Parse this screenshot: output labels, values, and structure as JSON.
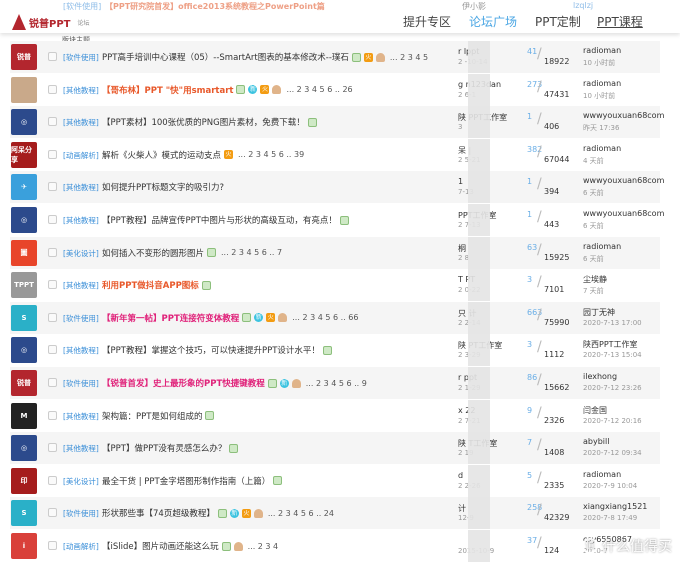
{
  "header": {
    "logo": "锐普PPT",
    "logo_sub": "论坛",
    "nav": [
      "提升专区",
      "论坛广场",
      "PPT定制",
      "PPT课程"
    ],
    "active": 1
  },
  "ghost_row": {
    "category": "[软件使用]",
    "title": "【PPT研究院首发】office2013系统教程之PowerPoint篇",
    "author": "伊小影",
    "last_user": "lzqlzj"
  },
  "board_label": "版块主题",
  "watermark": "什么值得买",
  "rows": [
    {
      "avatar": "锐普",
      "av_color": "#b3262e",
      "category": "[软件使用]",
      "title": "PPT高手培训中心课程（05）--SmartArt图表的基本修改术--璞石",
      "color": "#333",
      "badges": [
        "img",
        "hot",
        "thumb"
      ],
      "pages": "... 2 3 4 5",
      "author": "r    lppt",
      "date": "2   -10-14",
      "replies": "41",
      "views": "18922",
      "last_user": "radioman",
      "last_time": "10 小时前"
    },
    {
      "avatar": "",
      "av_color": "#c9a98a",
      "category": "[其他教程]",
      "title": "【哥布林】PPT \"快\"用smartart",
      "color": "#e8582a",
      "badges": [
        "img",
        "new",
        "hot",
        "thumb"
      ],
      "pages": "... 2 3 4 5 6 .. 26",
      "author": "g    n123dan",
      "date": "2   6-1",
      "replies": "273",
      "views": "47431",
      "last_user": "radioman",
      "last_time": "10 小时前"
    },
    {
      "avatar": "◎",
      "av_color": "#2c4a8c",
      "category": "[其他教程]",
      "title": "【PPT素材】100张优质的PNG图片素材，免费下载！",
      "color": "#333",
      "badges": [
        "img"
      ],
      "pages": "",
      "author": "陕    PPT工作室",
      "date": "3   ",
      "replies": "1",
      "views": "406",
      "last_user": "wwwyouxuan68com",
      "last_time": "昨天 17:36"
    },
    {
      "avatar": "阿呆分享",
      "av_color": "#a51c1c",
      "category": "[动画解析]",
      "title": "解析《火柴人》模式的运动支点",
      "color": "#333",
      "badges": [
        "hot"
      ],
      "pages": "... 2 3 4 5 6 .. 39",
      "author": "     呆 |",
      "date": "2   5-21",
      "replies": "382",
      "views": "67044",
      "last_user": "radioman",
      "last_time": "4 天前"
    },
    {
      "avatar": "✈",
      "av_color": "#3aa0dc",
      "category": "[其他教程]",
      "title": "如何提升PPT标题文字的吸引力?",
      "color": "#333",
      "badges": [],
      "pages": "",
      "author": "     1",
      "date": "   7-13",
      "replies": "1",
      "views": "394",
      "last_user": "wwwyouxuan68com",
      "last_time": "6 天前"
    },
    {
      "avatar": "◎",
      "av_color": "#2c4a8c",
      "category": "[其他教程]",
      "title": "【PPT教程】品牌宣传PPT中图片与形状的高级互动，有亮点！",
      "color": "#333",
      "badges": [
        "img"
      ],
      "pages": "",
      "author": "     PPT工作室",
      "date": "2   7-13",
      "replies": "1",
      "views": "443",
      "last_user": "wwwyouxuan68com",
      "last_time": "6 天前"
    },
    {
      "avatar": "圖",
      "av_color": "#e8452a",
      "category": "[美化设计]",
      "title": "如何插入不变形的圆形图片",
      "color": "#333",
      "badges": [
        "img"
      ],
      "pages": "... 2 3 4 5 6 .. 7",
      "author": "桐   ",
      "date": "2   8",
      "replies": "63",
      "views": "15925",
      "last_user": "radioman",
      "last_time": "6 天前"
    },
    {
      "avatar": "TPPT",
      "av_color": "#999",
      "category": "[其他教程]",
      "title": "利用PPT做抖音APP图标",
      "color": "#e8582a",
      "badges": [
        "img"
      ],
      "pages": "",
      "author": "T    PT",
      "date": "2   0-22",
      "replies": "3",
      "views": "7101",
      "last_user": "尘埃静",
      "last_time": "7 天前"
    },
    {
      "avatar": "S",
      "av_color": "#2ab0c8",
      "category": "[软件使用]",
      "title": "【新年第一帖】PPT连接符变体教程",
      "color": "#e0227a",
      "badges": [
        "img",
        "new",
        "hot",
        "thumb"
      ],
      "pages": "... 2 3 4 5 6 .. 66",
      "author": "只    计",
      "date": "2   2-14",
      "replies": "663",
      "views": "75990",
      "last_user": "园丁无神",
      "last_time": "2020-7-13 17:00"
    },
    {
      "avatar": "◎",
      "av_color": "#2c4a8c",
      "category": "[其他教程]",
      "title": "【PPT教程】掌握这个技巧，可以快速提升PPT设计水平！",
      "color": "#333",
      "badges": [
        "img"
      ],
      "pages": "",
      "author": "陕    PT工作室",
      "date": "2   3-29",
      "replies": "3",
      "views": "1112",
      "last_user": "陕西PPT工作室",
      "last_time": "2020-7-13 15:04"
    },
    {
      "avatar": "锐普",
      "av_color": "#b3262e",
      "category": "[软件使用]",
      "title": "【锐普首发】史上最形象的PPT快捷键教程",
      "color": "#e0227a",
      "badges": [
        "img",
        "new",
        "thumb"
      ],
      "pages": "... 2 3 4 5 6 .. 9",
      "author": "r    ppt",
      "date": "2   1-29",
      "replies": "86",
      "views": "15662",
      "last_user": "ilexhong",
      "last_time": "2020-7-12 23:26"
    },
    {
      "avatar": "M",
      "av_color": "#222",
      "category": "[其他教程]",
      "title": "架构篇：PPT是如何组成的",
      "color": "#333",
      "badges": [
        "img"
      ],
      "pages": "",
      "author": "x    22",
      "date": "2   7-21",
      "replies": "9",
      "views": "2326",
      "last_user": "闫金国",
      "last_time": "2020-7-12 20:16"
    },
    {
      "avatar": "◎",
      "av_color": "#2c4a8c",
      "category": "[其他教程]",
      "title": "【PPT】做PPT没有灵感怎么办？",
      "color": "#333",
      "badges": [
        "img"
      ],
      "pages": "",
      "author": "陕    T工作室",
      "date": "2   19",
      "replies": "7",
      "views": "1408",
      "last_user": "abybill",
      "last_time": "2020-7-12 09:34"
    },
    {
      "avatar": "印",
      "av_color": "#a51c1c",
      "category": "[美化设计]",
      "title": "最全干货 | PPT金字塔图形制作指南（上篇）",
      "color": "#333",
      "badges": [
        "img"
      ],
      "pages": "",
      "author": "d    ",
      "date": "2   2-26",
      "replies": "5",
      "views": "2335",
      "last_user": "radioman",
      "last_time": "2020-7-9 10:04"
    },
    {
      "avatar": "S",
      "av_color": "#2ab0c8",
      "category": "[软件使用]",
      "title": "形状那些事【74页超级教程】",
      "color": "#333",
      "badges": [
        "img",
        "new",
        "hot",
        "thumb"
      ],
      "pages": "... 2 3 4 5 6 .. 24",
      "author": "     计",
      "date": "   12-9",
      "replies": "258",
      "views": "42329",
      "last_user": "xiangxiang1521",
      "last_time": "2020-7-8 17:49"
    },
    {
      "avatar": "i",
      "av_color": "#d9403a",
      "category": "[动画解析]",
      "title": "【iSlide】图片动画还能这么玩",
      "color": "#333",
      "badges": [
        "img",
        "thumb"
      ],
      "pages": "... 2 3 4",
      "author": "     ",
      "date": "2015-10-9",
      "replies": "37",
      "views": "124",
      "last_user": "csy6550867",
      "last_time": "2020-7"
    }
  ]
}
